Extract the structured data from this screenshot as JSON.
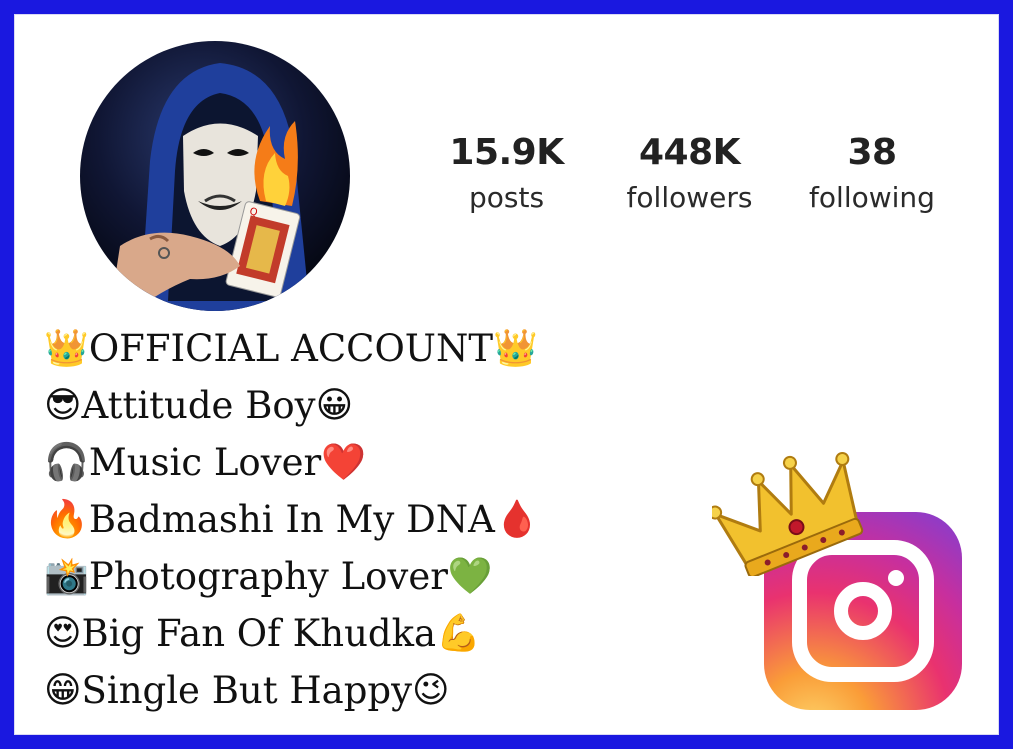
{
  "profile": {
    "stats": {
      "posts": {
        "value": "15.9K",
        "label": "posts"
      },
      "followers": {
        "value": "448K",
        "label": "followers"
      },
      "following": {
        "value": "38",
        "label": "following"
      }
    },
    "bio": [
      {
        "lead": "👑",
        "text": "OFFICIAL ACCOUNT",
        "trail": "👑"
      },
      {
        "lead": "😎",
        "text": "Attitude Boy",
        "trail": "😀"
      },
      {
        "lead": "🎧",
        "text": "Music Lover",
        "trail": "❤️"
      },
      {
        "lead": "🔥",
        "text": "Badmashi In My DNA",
        "trail": "🩸"
      },
      {
        "lead": "📸",
        "text": "Photography Lover",
        "trail": "💚"
      },
      {
        "lead": "😍",
        "text": "Big Fan Of Khudka",
        "trail": "💪"
      },
      {
        "lead": "😁",
        "text": "Single But Happy",
        "trail": "😉"
      }
    ]
  },
  "colors": {
    "border": "#1a18e0",
    "background": "#ffffff",
    "text": "#111111"
  },
  "icons": {
    "avatar": "masked-hooded-man-with-burning-card",
    "logo": "instagram-logo-icon",
    "crown": "crown-icon"
  }
}
